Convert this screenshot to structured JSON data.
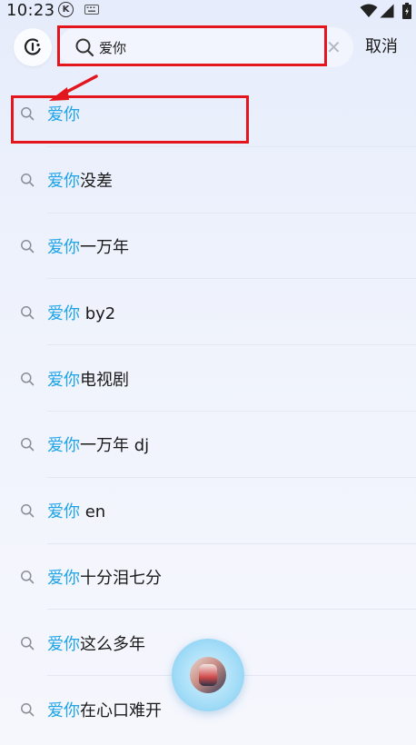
{
  "status_bar": {
    "time": "10:23",
    "k_badge": "K",
    "icons": [
      "k-icon",
      "keyboard-icon",
      "wifi-icon",
      "signal-icon",
      "battery-icon"
    ]
  },
  "header": {
    "voice_icon": "voice-search-icon",
    "search": {
      "value": "爱你",
      "icon": "search-icon",
      "clear_icon": "close-icon"
    },
    "cancel_label": "取消"
  },
  "suggestions": [
    {
      "highlight": "爱你",
      "rest": ""
    },
    {
      "highlight": "爱你",
      "rest": "没差"
    },
    {
      "highlight": "爱你",
      "rest": "一万年"
    },
    {
      "highlight": "爱你",
      "rest": " by2"
    },
    {
      "highlight": "爱你",
      "rest": "电视剧"
    },
    {
      "highlight": "爱你",
      "rest": "一万年 dj"
    },
    {
      "highlight": "爱你",
      "rest": " en"
    },
    {
      "highlight": "爱你",
      "rest": "十分泪七分"
    },
    {
      "highlight": "爱你",
      "rest": "这么多年"
    },
    {
      "highlight": "爱你",
      "rest": "在心口难开"
    }
  ],
  "colors": {
    "highlight": "#1fa4e8",
    "annotation": "#e3161e",
    "text": "#1a1a1a"
  },
  "floating_player": {
    "icon": "album-art-icon"
  }
}
